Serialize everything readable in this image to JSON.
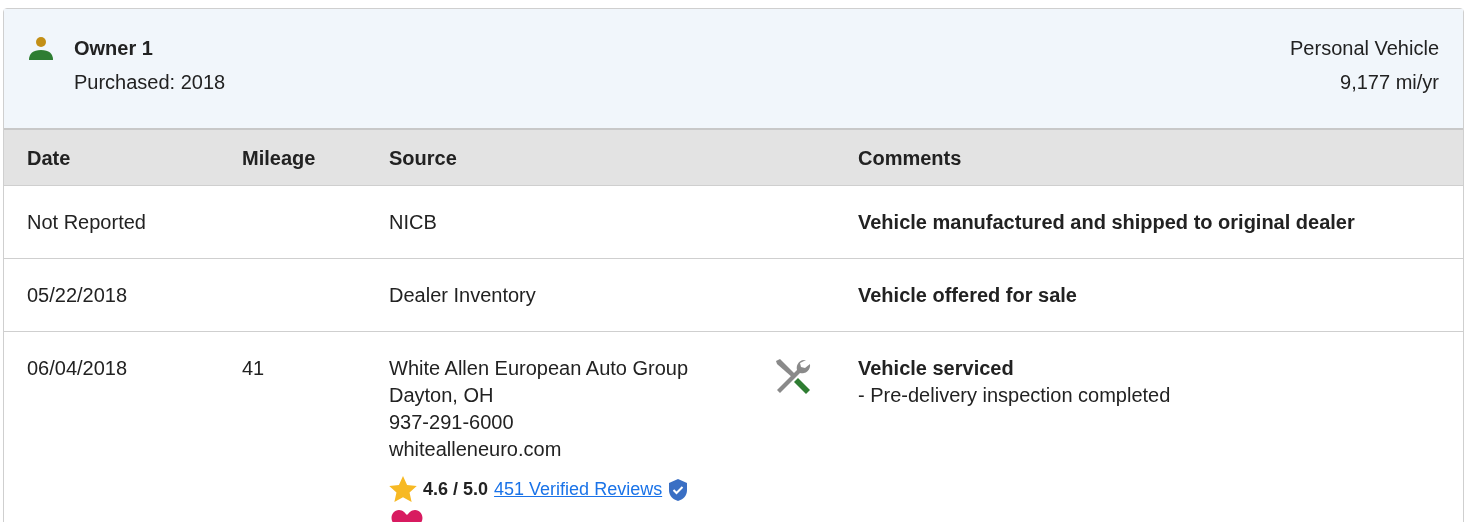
{
  "owner": {
    "title": "Owner 1",
    "purchased": "Purchased: 2018",
    "usage": "Personal Vehicle",
    "mileage_rate": "9,177 mi/yr"
  },
  "table": {
    "columns": [
      "Date",
      "Mileage",
      "Source",
      "Comments"
    ],
    "rows": [
      {
        "date": "Not Reported",
        "mileage": "",
        "source": [
          "NICB"
        ],
        "service": false,
        "comment": "Vehicle manufactured and shipped to original dealer",
        "details": []
      },
      {
        "date": "05/22/2018",
        "mileage": "",
        "source": [
          "Dealer Inventory"
        ],
        "service": false,
        "comment": "Vehicle offered for sale",
        "details": []
      },
      {
        "date": "06/04/2018",
        "mileage": "41",
        "source": [
          "White Allen European Auto Group",
          "Dayton, OH",
          "937-291-6000",
          "whitealleneuro.com"
        ],
        "service": true,
        "comment": "Vehicle serviced",
        "details": [
          "- Pre-delivery inspection completed"
        ],
        "rating": {
          "score": "4.6 / 5.0",
          "reviews": "451 Verified Reviews",
          "verified": true
        },
        "fans": true
      }
    ]
  }
}
